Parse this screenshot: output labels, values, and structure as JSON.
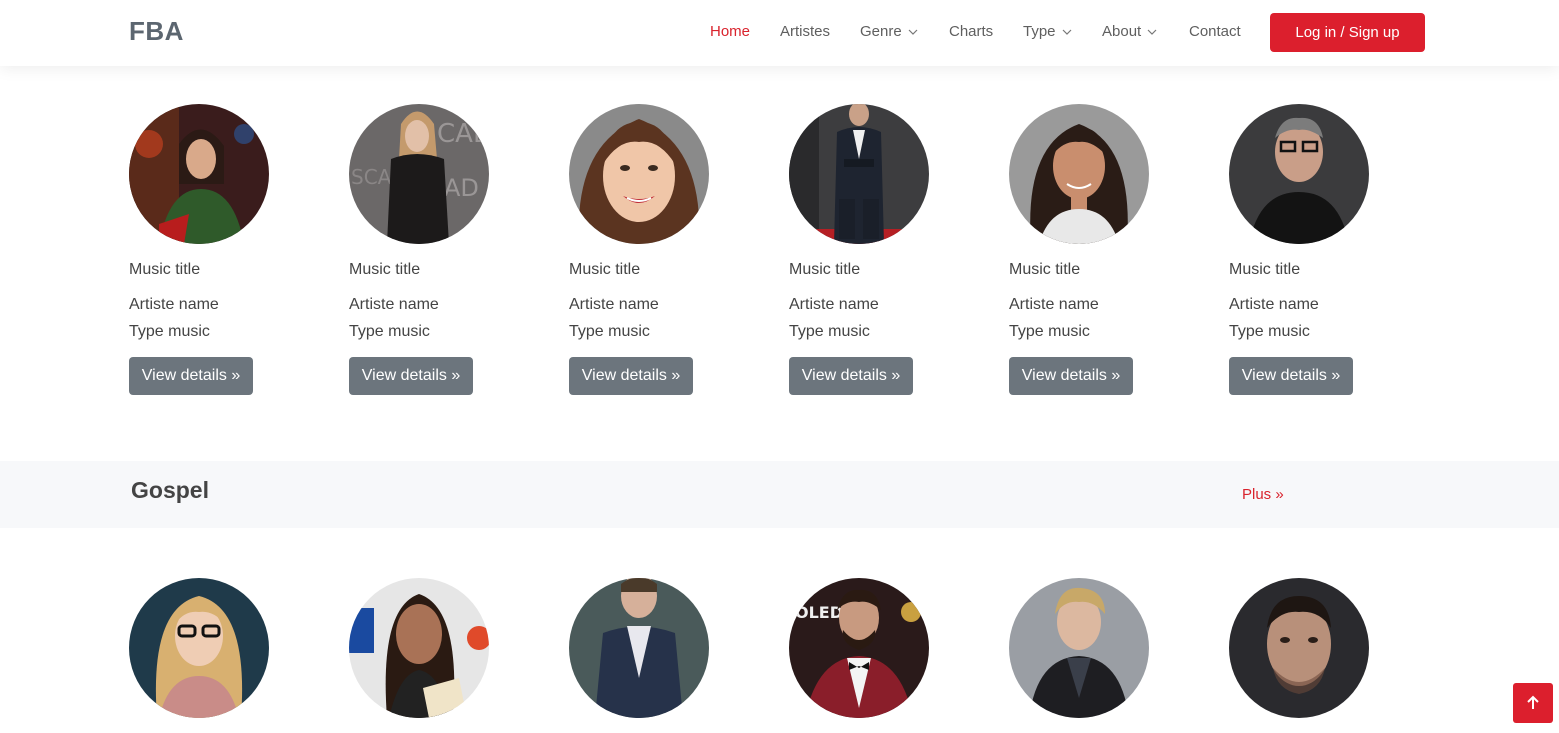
{
  "brand": {
    "logo": "FBA"
  },
  "nav": {
    "items": [
      {
        "label": "Home",
        "active": true,
        "dropdown": false
      },
      {
        "label": "Artistes",
        "active": false,
        "dropdown": false
      },
      {
        "label": "Genre",
        "active": false,
        "dropdown": true
      },
      {
        "label": "Charts",
        "active": false,
        "dropdown": false
      },
      {
        "label": "Type",
        "active": false,
        "dropdown": true
      },
      {
        "label": "About",
        "active": false,
        "dropdown": true
      },
      {
        "label": "Contact",
        "active": false,
        "dropdown": false
      }
    ],
    "login_label": "Log in / Sign up"
  },
  "top_cards": [
    {
      "title": "Music title",
      "artist": "Artiste name",
      "type": "Type music",
      "button": "View details »"
    },
    {
      "title": "Music title",
      "artist": "Artiste name",
      "type": "Type music",
      "button": "View details »"
    },
    {
      "title": "Music title",
      "artist": "Artiste name",
      "type": "Type music",
      "button": "View details »"
    },
    {
      "title": "Music title",
      "artist": "Artiste name",
      "type": "Type music",
      "button": "View details »"
    },
    {
      "title": "Music title",
      "artist": "Artiste name",
      "type": "Type music",
      "button": "View details »"
    },
    {
      "title": "Music title",
      "artist": "Artiste name",
      "type": "Type music",
      "button": "View details »"
    }
  ],
  "section": {
    "title": "Gospel",
    "more_label": "Plus »"
  },
  "colors": {
    "accent": "#dc1f2d",
    "button_gray": "#6c757d",
    "section_bg": "#f7f8fa"
  },
  "icons": {
    "scroll_top": "arrow-up-icon",
    "dropdown": "chevron-down-icon"
  }
}
